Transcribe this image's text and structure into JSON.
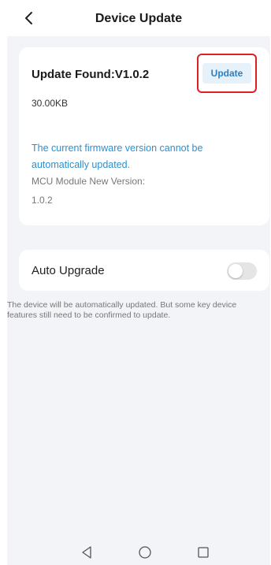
{
  "header": {
    "title": "Device Update",
    "back_icon": "chevron-left-icon"
  },
  "update_card": {
    "title": "Update Found:V1.0.2",
    "size": "30.00KB",
    "button_label": "Update",
    "warning": "The current firmware version cannot be automatically updated.",
    "mcu_label": "MCU Module New Version:",
    "mcu_version": "1.0.2"
  },
  "auto_upgrade": {
    "label": "Auto Upgrade",
    "enabled": false,
    "description": "The device will be automatically updated. But some key device features still need to be confirmed to update."
  },
  "nav_bar": {
    "back_icon": "triangle-back-icon",
    "home_icon": "circle-home-icon",
    "recent_icon": "square-recent-icon"
  },
  "colors": {
    "accent": "#2a80c2",
    "warning_text": "#2b8fcf",
    "highlight": "#e02020",
    "background": "#f2f4f7"
  }
}
